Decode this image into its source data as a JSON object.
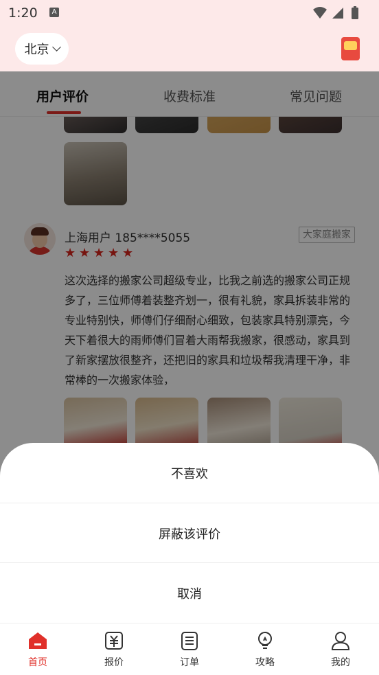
{
  "status_bar": {
    "time": "1:20",
    "a_icon": "A"
  },
  "header": {
    "city": "北京",
    "city_chevron_icon": "chevron-down-icon",
    "redpack_icon": "red-envelope-icon"
  },
  "tabs": [
    {
      "label": "用户评价",
      "active": true
    },
    {
      "label": "收费标准",
      "active": false
    },
    {
      "label": "常见问题",
      "active": false
    }
  ],
  "review": {
    "user": "上海用户 185****5055",
    "badge": "大家庭搬家",
    "rating": 5,
    "text": "这次选择的搬家公司超级专业，比我之前选的搬家公司正规多了，三位师傅着装整齐划一，很有礼貌，家具拆装非常的专业特别快，师傅们仔细耐心细致，包装家具特别漂亮，今天下着很大的雨师傅们冒着大雨帮我搬家，很感动，家具到了新家摆放很整齐，还把旧的家具和垃圾帮我清理干净，非常棒的一次搬家体验，"
  },
  "sheet": {
    "dislike": "不喜欢",
    "block": "屏蔽该评价",
    "cancel": "取消"
  },
  "bottom_nav": [
    {
      "label": "首页",
      "icon": "home-icon",
      "active": true
    },
    {
      "label": "报价",
      "icon": "price-icon",
      "active": false
    },
    {
      "label": "订单",
      "icon": "order-icon",
      "active": false
    },
    {
      "label": "攻略",
      "icon": "bulb-icon",
      "active": false
    },
    {
      "label": "我的",
      "icon": "user-icon",
      "active": false
    }
  ],
  "colors": {
    "accent": "#e0302a",
    "header_bg": "#fde9e9",
    "star": "#d8251d"
  }
}
